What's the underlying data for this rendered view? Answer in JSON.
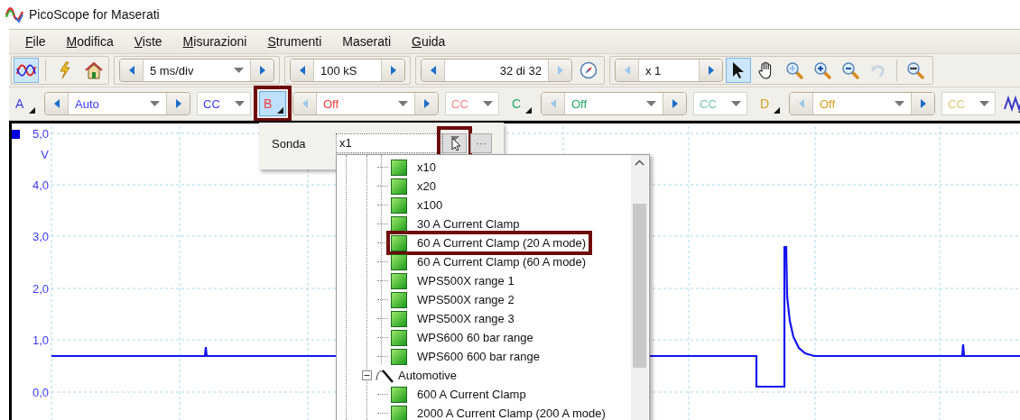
{
  "window": {
    "title": "PicoScope for Maserati"
  },
  "menu": [
    {
      "label": "File",
      "mnemonic": true
    },
    {
      "label": "Modifica",
      "mnemonic": true
    },
    {
      "label": "Viste",
      "mnemonic": true
    },
    {
      "label": "Misurazioni",
      "mnemonic": true
    },
    {
      "label": "Strumenti",
      "mnemonic": true
    },
    {
      "label": "Maserati",
      "mnemonic": false
    },
    {
      "label": "Guida",
      "mnemonic": true
    }
  ],
  "toolbar": {
    "mode_selected": true,
    "timebase": {
      "value": "5 ms/div",
      "prev_disabled": false,
      "next_disabled": false
    },
    "samples": {
      "value": "100 kS",
      "prev_disabled": false,
      "next_disabled": false
    },
    "buffer": {
      "value": "32 di 32",
      "prev_disabled": false,
      "next_disabled": true
    },
    "zoom": {
      "value": "x 1",
      "prev_disabled": true,
      "next_disabled": false
    },
    "tools": [
      {
        "kind": "pointer",
        "selected": true,
        "disabled": false
      },
      {
        "kind": "hand",
        "selected": false,
        "disabled": false
      },
      {
        "kind": "zoom-fit",
        "selected": false,
        "disabled": false
      },
      {
        "kind": "zoom-in",
        "selected": false,
        "disabled": false
      },
      {
        "kind": "zoom-out",
        "selected": false,
        "disabled": false
      },
      {
        "kind": "undo",
        "selected": false,
        "disabled": true
      },
      {
        "kind": "zoom-full",
        "selected": false,
        "disabled": false
      }
    ]
  },
  "channels": [
    {
      "name": "A",
      "color": "#3c3cf0",
      "range": "Auto",
      "coupling": "CC",
      "enabled": true,
      "selected": false,
      "annotated": false
    },
    {
      "name": "B",
      "color": "#f03c3c",
      "range": "Off",
      "coupling": "CC",
      "enabled": false,
      "selected": true,
      "annotated": true
    },
    {
      "name": "C",
      "color": "#22aa66",
      "range": "Off",
      "coupling": "CC",
      "enabled": false,
      "selected": false,
      "annotated": false
    },
    {
      "name": "D",
      "color": "#d4a020",
      "range": "Off",
      "coupling": "CC",
      "enabled": false,
      "selected": false,
      "annotated": false
    }
  ],
  "scope": {
    "unit": "V",
    "y_labels": [
      "5,0",
      "4,0",
      "3,0",
      "2,0",
      "1,0",
      "0,0"
    ]
  },
  "probe_popup": {
    "label": "Sonda",
    "value": "x1",
    "dropdown_annotated": true,
    "more": "···",
    "tree": [
      {
        "children": [
          {
            "label": "x10",
            "annotated": false
          },
          {
            "label": "x20",
            "annotated": false
          },
          {
            "label": "x100",
            "annotated": false
          },
          {
            "label": "30 A Current Clamp",
            "annotated": false
          },
          {
            "label": "60 A Current Clamp (20 A mode)",
            "annotated": true
          },
          {
            "label": "60 A Current Clamp (60 A mode)",
            "annotated": false
          },
          {
            "label": "WPS500X range 1",
            "annotated": false
          },
          {
            "label": "WPS500X range 2",
            "annotated": false
          },
          {
            "label": "WPS500X range 3",
            "annotated": false
          },
          {
            "label": "WPS600 60 bar range",
            "annotated": false
          },
          {
            "label": "WPS600 600 bar range",
            "annotated": false
          }
        ]
      },
      {
        "label": "Automotive",
        "expanded": true,
        "children": [
          {
            "label": "600 A Current Clamp",
            "annotated": false
          },
          {
            "label": "2000 A Current Clamp (200 A mode)",
            "annotated": false
          }
        ]
      }
    ]
  }
}
